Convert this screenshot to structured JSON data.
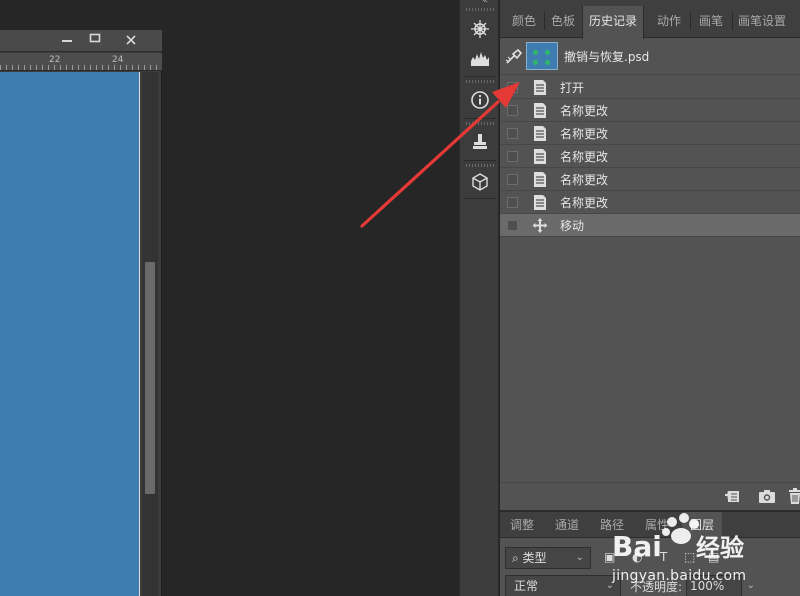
{
  "document_window": {
    "minimize_icon": "minimize-icon",
    "maximize_icon": "maximize-icon",
    "close_icon": "close-icon",
    "ruler": {
      "labels": [
        "22",
        "24"
      ]
    },
    "canvas_color": "#3f7cb0"
  },
  "tool_strip": {
    "icons": [
      "navigator-icon",
      "histogram-icon",
      "info-icon",
      "clone-source-icon",
      "3d-cube-icon"
    ]
  },
  "history_panel": {
    "tabs": [
      {
        "label": "颜色",
        "active": false
      },
      {
        "label": "色板",
        "active": false
      },
      {
        "label": "历史记录",
        "active": true
      },
      {
        "label": "动作",
        "active": false
      },
      {
        "label": "画笔",
        "active": false
      },
      {
        "label": "画笔设置",
        "active": false
      }
    ],
    "snapshot": {
      "name": "撤销与恢复.psd"
    },
    "states": [
      {
        "label": "打开",
        "icon": "document-icon"
      },
      {
        "label": "名称更改",
        "icon": "document-icon"
      },
      {
        "label": "名称更改",
        "icon": "document-icon"
      },
      {
        "label": "名称更改",
        "icon": "document-icon"
      },
      {
        "label": "名称更改",
        "icon": "document-icon"
      },
      {
        "label": "名称更改",
        "icon": "document-icon"
      },
      {
        "label": "移动",
        "icon": "move-icon",
        "current": true
      }
    ],
    "footer_icons": [
      "new-document-icon",
      "camera-icon",
      "trash-icon"
    ]
  },
  "layers_panel": {
    "tabs": [
      {
        "label": "调整",
        "active": false
      },
      {
        "label": "通道",
        "active": false
      },
      {
        "label": "路径",
        "active": false
      },
      {
        "label": "属性",
        "active": false
      },
      {
        "label": "图层",
        "active": true
      }
    ],
    "filter": {
      "label": "类型"
    },
    "blend_mode": {
      "value": "正常"
    },
    "opacity": {
      "label": "不透明度:",
      "value": "100%"
    }
  },
  "watermark": {
    "text": "jingyan.baidu.com",
    "brand": "Baidu 经验"
  },
  "colors": {
    "panel_bg": "#535353",
    "app_bg": "#262626",
    "annotation_arrow": "#e53935"
  }
}
